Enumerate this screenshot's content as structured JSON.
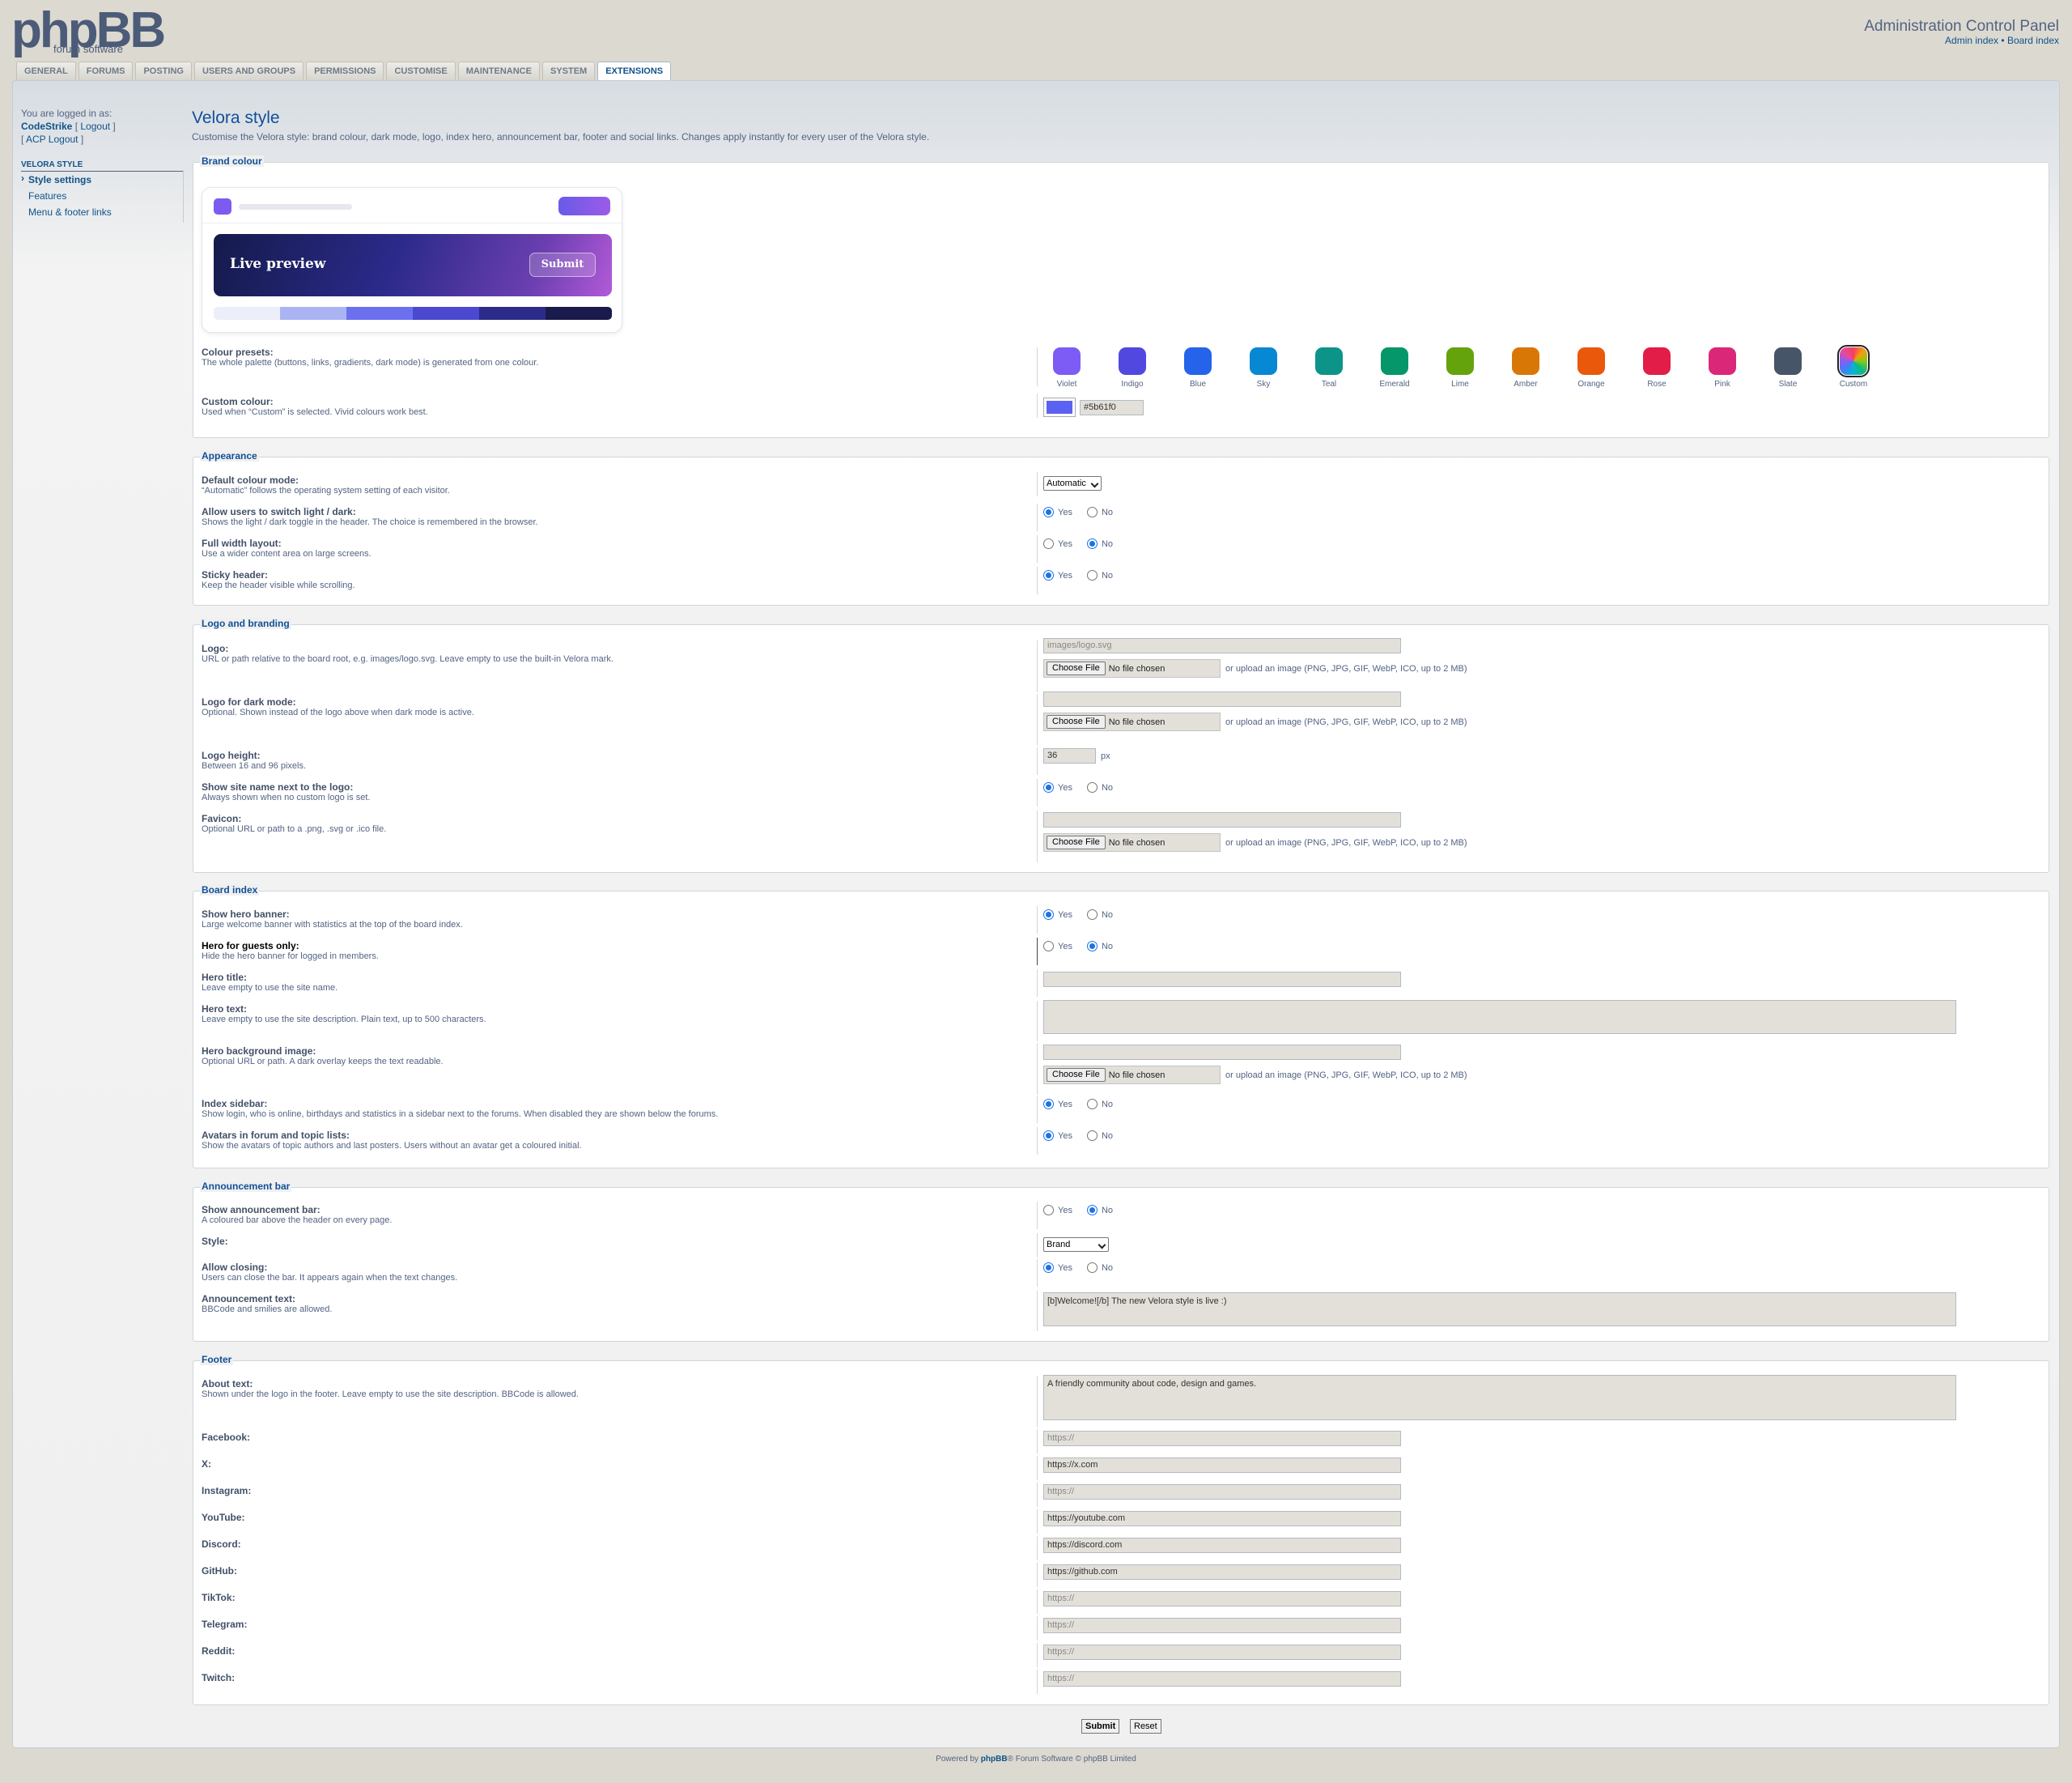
{
  "header": {
    "logo_text": "phpBB",
    "logo_sub": "forum software",
    "acp_title": "Administration Control Panel",
    "admin_index": "Admin index",
    "board_index": "Board index",
    "sep": "•"
  },
  "tabs": [
    "General",
    "Forums",
    "Posting",
    "Users and Groups",
    "Permissions",
    "Customise",
    "Maintenance",
    "System",
    "Extensions"
  ],
  "user": {
    "logged_in_as": "You are logged in as:",
    "username": "CodeStrike",
    "logout": "Logout",
    "acp_logout": "ACP Logout"
  },
  "menu": {
    "category": "VELORA STYLE",
    "items": [
      "Style settings",
      "Features",
      "Menu & footer links"
    ]
  },
  "page": {
    "title": "Velora style",
    "description": "Customise the Velora style: brand colour, dark mode, logo, index hero, announcement bar, footer and social links. Changes apply instantly for every user of the Velora style."
  },
  "brand": {
    "legend": "Brand colour",
    "preview_title": "Live preview",
    "preview_button": "Submit",
    "scale": [
      "#eceef9",
      "#aab4f3",
      "#6c70ef",
      "#4b49cf",
      "#2d2b8a",
      "#1a1a4d"
    ],
    "presets_label": "Colour presets:",
    "presets_desc": "The whole palette (buttons, links, gradients, dark mode) is generated from one colour.",
    "presets": [
      {
        "name": "Violet",
        "color": "#7c5cf5"
      },
      {
        "name": "Indigo",
        "color": "#5148e0"
      },
      {
        "name": "Blue",
        "color": "#2563eb"
      },
      {
        "name": "Sky",
        "color": "#0788d3"
      },
      {
        "name": "Teal",
        "color": "#0d9488"
      },
      {
        "name": "Emerald",
        "color": "#059669"
      },
      {
        "name": "Lime",
        "color": "#65a30d"
      },
      {
        "name": "Amber",
        "color": "#d97706"
      },
      {
        "name": "Orange",
        "color": "#ea580c"
      },
      {
        "name": "Rose",
        "color": "#e11d48"
      },
      {
        "name": "Pink",
        "color": "#db2777"
      },
      {
        "name": "Slate",
        "color": "#475569"
      },
      {
        "name": "Custom",
        "color": "conic"
      }
    ],
    "custom_label": "Custom colour:",
    "custom_desc": "Used when “Custom” is selected. Vivid colours work best.",
    "custom_value": "#5b61f0"
  },
  "appearance": {
    "legend": "Appearance",
    "mode_label": "Default colour mode:",
    "mode_desc": "“Automatic” follows the operating system setting of each visitor.",
    "mode_value": "Automatic",
    "switch_label": "Allow users to switch light / dark:",
    "switch_desc": "Shows the light / dark toggle in the header. The choice is remembered in the browser.",
    "full_label": "Full width layout:",
    "full_desc": "Use a wider content area on large screens.",
    "sticky_label": "Sticky header:",
    "sticky_desc": "Keep the header visible while scrolling."
  },
  "yes": "Yes",
  "no": "No",
  "upload_note": "or upload an image (PNG, JPG, GIF, WebP, ICO, up to 2 MB)",
  "choose_file": "Choose File",
  "no_file": "No file chosen",
  "logo": {
    "legend": "Logo and branding",
    "logo_label": "Logo:",
    "logo_desc": "URL or path relative to the board root, e.g. images/logo.svg. Leave empty to use the built-in Velora mark.",
    "logo_placeholder": "images/logo.svg",
    "dark_label": "Logo for dark mode:",
    "dark_desc": "Optional. Shown instead of the logo above when dark mode is active.",
    "height_label": "Logo height:",
    "height_desc": "Between 16 and 96 pixels.",
    "height_value": "36",
    "height_unit": "px",
    "sitename_label": "Show site name next to the logo:",
    "sitename_desc": "Always shown when no custom logo is set.",
    "favicon_label": "Favicon:",
    "favicon_desc": "Optional URL or path to a .png, .svg or .ico file."
  },
  "index": {
    "legend": "Board index",
    "hero_label": "Show hero banner:",
    "hero_desc": "Large welcome banner with statistics at the top of the board index.",
    "guests_label": "Hero for guests only:",
    "guests_desc": "Hide the hero banner for logged in members.",
    "title_label": "Hero title:",
    "title_desc": "Leave empty to use the site name.",
    "text_label": "Hero text:",
    "text_desc": "Leave empty to use the site description. Plain text, up to 500 characters.",
    "bg_label": "Hero background image:",
    "bg_desc": "Optional URL or path. A dark overlay keeps the text readable.",
    "sidebar_label": "Index sidebar:",
    "sidebar_desc": "Show login, who is online, birthdays and statistics in a sidebar next to the forums. When disabled they are shown below the forums.",
    "avatars_label": "Avatars in forum and topic lists:",
    "avatars_desc": "Show the avatars of topic authors and last posters. Users without an avatar get a coloured initial."
  },
  "announce": {
    "legend": "Announcement bar",
    "show_label": "Show announcement bar:",
    "show_desc": "A coloured bar above the header on every page.",
    "style_label": "Style:",
    "style_value": "Brand",
    "close_label": "Allow closing:",
    "close_desc": "Users can close the bar. It appears again when the text changes.",
    "text_label": "Announcement text:",
    "text_desc": "BBCode and smilies are allowed.",
    "text_value": "[b]Welcome![/b] The new Velora style is live :)"
  },
  "footer": {
    "legend": "Footer",
    "about_label": "About text:",
    "about_desc": "Shown under the logo in the footer. Leave empty to use the site description. BBCode is allowed.",
    "about_value": "A friendly community about code, design and games.",
    "social": [
      {
        "label": "Facebook:",
        "value": "https://",
        "ph": true
      },
      {
        "label": "X:",
        "value": "https://x.com",
        "ph": false
      },
      {
        "label": "Instagram:",
        "value": "https://",
        "ph": true
      },
      {
        "label": "YouTube:",
        "value": "https://youtube.com",
        "ph": false
      },
      {
        "label": "Discord:",
        "value": "https://discord.com",
        "ph": false
      },
      {
        "label": "GitHub:",
        "value": "https://github.com",
        "ph": false
      },
      {
        "label": "TikTok:",
        "value": "https://",
        "ph": true
      },
      {
        "label": "Telegram:",
        "value": "https://",
        "ph": true
      },
      {
        "label": "Reddit:",
        "value": "https://",
        "ph": true
      },
      {
        "label": "Twitch:",
        "value": "https://",
        "ph": true
      }
    ]
  },
  "buttons": {
    "submit": "Submit",
    "reset": "Reset"
  },
  "copyright": {
    "pre": "Powered by ",
    "brand": "phpBB",
    "post": "® Forum Software © phpBB Limited"
  }
}
